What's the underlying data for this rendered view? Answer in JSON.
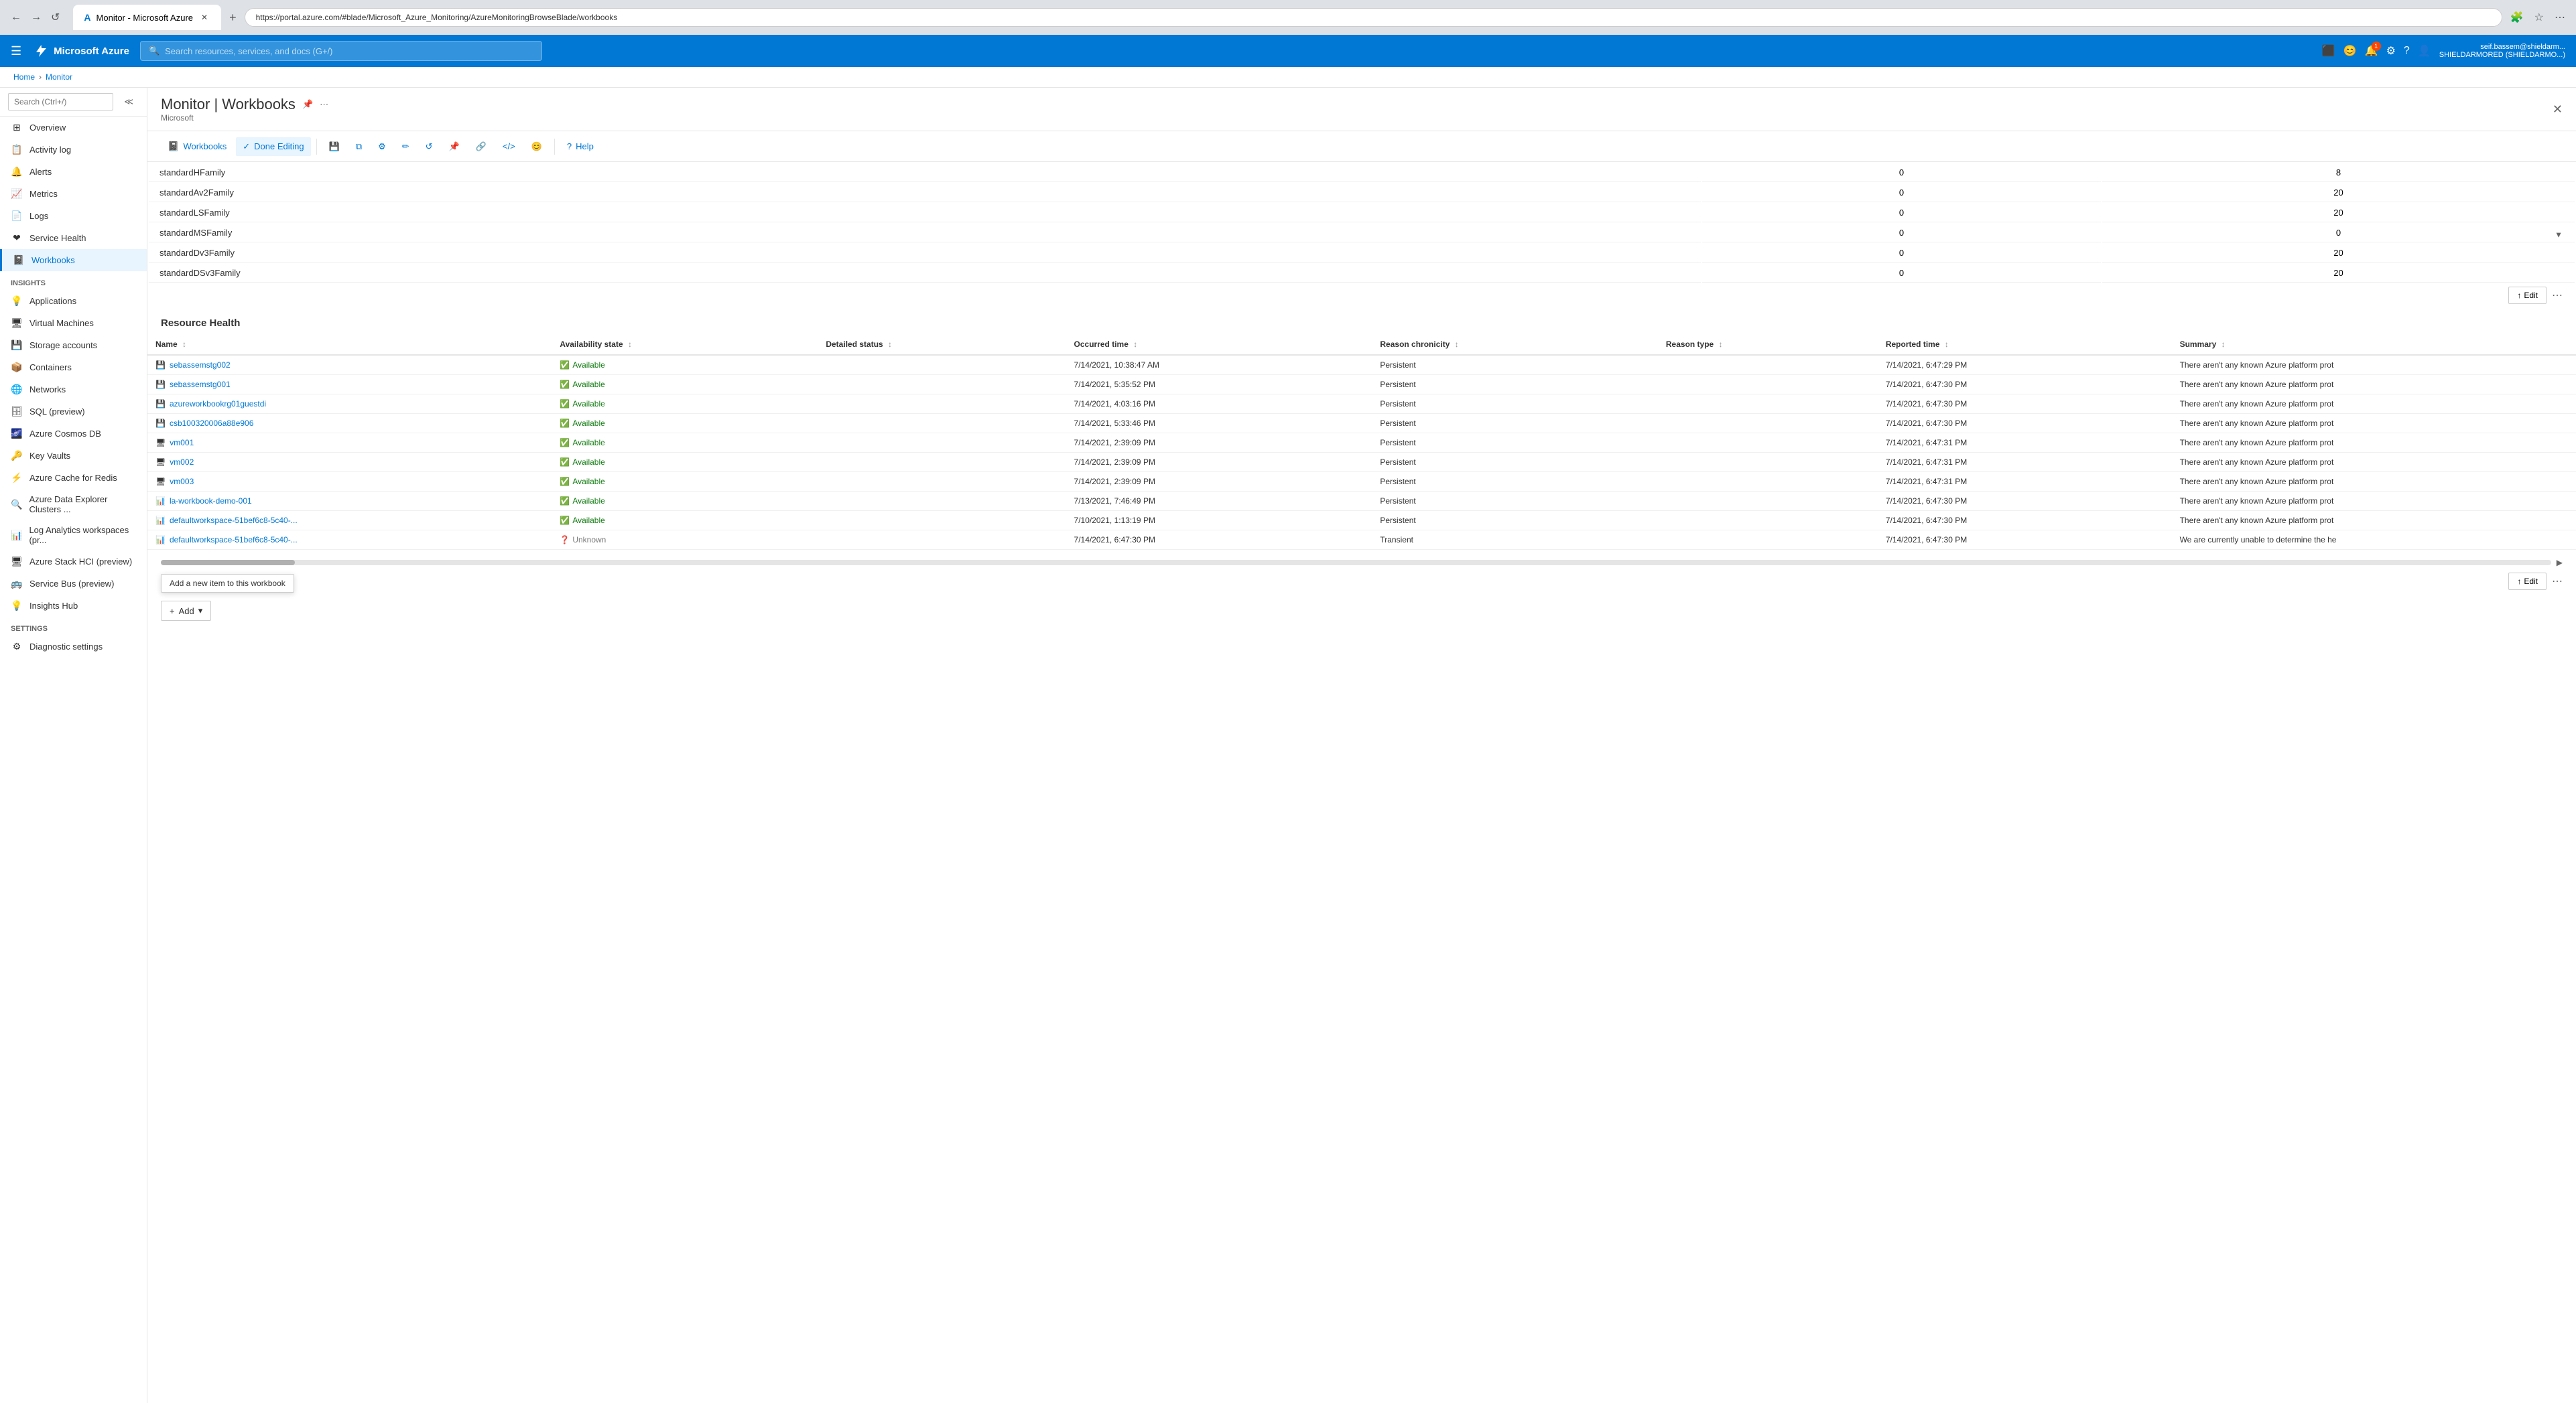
{
  "browser": {
    "tab_title": "Monitor - Microsoft Azure",
    "url": "https://portal.azure.com/#blade/Microsoft_Azure_Monitoring/AzureMonitoringBrowseBlade/workbooks",
    "favicon": "M"
  },
  "topbar": {
    "app_name": "Microsoft Azure",
    "search_placeholder": "Search resources, services, and docs (G+/)",
    "notification_count": "1",
    "user_name": "seif.bassem@shieldarm...",
    "user_org": "SHIELDARMORED (SHIELDARMO...)"
  },
  "breadcrumb": {
    "home": "Home",
    "monitor": "Monitor"
  },
  "page": {
    "title": "Monitor | Workbooks",
    "subtitle": "Microsoft"
  },
  "toolbar": {
    "workbooks_label": "Workbooks",
    "done_editing_label": "Done Editing",
    "help_label": "Help",
    "save_tooltip": "Save",
    "copy_tooltip": "Copy",
    "settings_tooltip": "Settings",
    "edit_tooltip": "Edit",
    "refresh_tooltip": "Refresh",
    "pin_tooltip": "Pin",
    "link_tooltip": "Link",
    "code_tooltip": "Code",
    "emoji_tooltip": "Emoji"
  },
  "sidebar": {
    "search_placeholder": "Search (Ctrl+/)",
    "items": [
      {
        "label": "Overview",
        "icon": "⊞",
        "active": false
      },
      {
        "label": "Activity log",
        "icon": "📋",
        "active": false
      },
      {
        "label": "Alerts",
        "icon": "🔔",
        "active": false
      },
      {
        "label": "Metrics",
        "icon": "📈",
        "active": false
      },
      {
        "label": "Logs",
        "icon": "📄",
        "active": false
      },
      {
        "label": "Service Health",
        "icon": "❤",
        "active": false
      },
      {
        "label": "Workbooks",
        "icon": "📓",
        "active": true
      }
    ],
    "insights_section": "Insights",
    "insights_items": [
      {
        "label": "Applications",
        "icon": "💡"
      },
      {
        "label": "Virtual Machines",
        "icon": "🖥"
      },
      {
        "label": "Storage accounts",
        "icon": "💾"
      },
      {
        "label": "Containers",
        "icon": "📦"
      },
      {
        "label": "Networks",
        "icon": "🌐"
      },
      {
        "label": "SQL (preview)",
        "icon": "🗄"
      },
      {
        "label": "Azure Cosmos DB",
        "icon": "🌌"
      },
      {
        "label": "Key Vaults",
        "icon": "🔑"
      },
      {
        "label": "Azure Cache for Redis",
        "icon": "⚡"
      },
      {
        "label": "Azure Data Explorer Clusters ...",
        "icon": "🔍"
      },
      {
        "label": "Log Analytics workspaces (pr...",
        "icon": "📊"
      },
      {
        "label": "Azure Stack HCI (preview)",
        "icon": "🖥"
      },
      {
        "label": "Service Bus (preview)",
        "icon": "🚌"
      },
      {
        "label": "Insights Hub",
        "icon": "💡"
      }
    ],
    "settings_section": "Settings",
    "settings_items": [
      {
        "label": "Diagnostic settings",
        "icon": "⚙"
      }
    ]
  },
  "family_table": {
    "rows": [
      {
        "name": "standardHFamily",
        "col2": "0",
        "col3": "8"
      },
      {
        "name": "standardAv2Family",
        "col2": "0",
        "col3": "20"
      },
      {
        "name": "standardLSFamily",
        "col2": "0",
        "col3": "20"
      },
      {
        "name": "standardMSFamily",
        "col2": "0",
        "col3": "0"
      },
      {
        "name": "standardDv3Family",
        "col2": "0",
        "col3": "20"
      },
      {
        "name": "standardDSv3Family",
        "col2": "0",
        "col3": "20"
      }
    ]
  },
  "resource_health": {
    "section_title": "Resource Health",
    "edit_btn_label": "↑ Edit",
    "more_btn_label": "...",
    "columns": [
      {
        "label": "Name"
      },
      {
        "label": "Availability state"
      },
      {
        "label": "Detailed status"
      },
      {
        "label": "Occurred time"
      },
      {
        "label": "Reason chronicity"
      },
      {
        "label": "Reason type"
      },
      {
        "label": "Reported time"
      },
      {
        "label": "Summary"
      }
    ],
    "rows": [
      {
        "name": "sebassemstg002",
        "type": "storage",
        "availability": "Available",
        "detailed_status": "",
        "occurred_time": "7/14/2021, 10:38:47 AM",
        "reason_chronicity": "Persistent",
        "reason_type": "",
        "reported_time": "7/14/2021, 6:47:29 PM",
        "summary": "There aren't any known Azure platform prot"
      },
      {
        "name": "sebassemstg001",
        "type": "storage",
        "availability": "Available",
        "detailed_status": "",
        "occurred_time": "7/14/2021, 5:35:52 PM",
        "reason_chronicity": "Persistent",
        "reason_type": "",
        "reported_time": "7/14/2021, 6:47:30 PM",
        "summary": "There aren't any known Azure platform prot"
      },
      {
        "name": "azureworkbookrg01guestdi",
        "type": "storage",
        "availability": "Available",
        "detailed_status": "",
        "occurred_time": "7/14/2021, 4:03:16 PM",
        "reason_chronicity": "Persistent",
        "reason_type": "",
        "reported_time": "7/14/2021, 6:47:30 PM",
        "summary": "There aren't any known Azure platform prot"
      },
      {
        "name": "csb100320006a88e906",
        "type": "storage",
        "availability": "Available",
        "detailed_status": "",
        "occurred_time": "7/14/2021, 5:33:46 PM",
        "reason_chronicity": "Persistent",
        "reason_type": "",
        "reported_time": "7/14/2021, 6:47:30 PM",
        "summary": "There aren't any known Azure platform prot"
      },
      {
        "name": "vm001",
        "type": "vm",
        "availability": "Available",
        "detailed_status": "",
        "occurred_time": "7/14/2021, 2:39:09 PM",
        "reason_chronicity": "Persistent",
        "reason_type": "",
        "reported_time": "7/14/2021, 6:47:31 PM",
        "summary": "There aren't any known Azure platform prot"
      },
      {
        "name": "vm002",
        "type": "vm",
        "availability": "Available",
        "detailed_status": "",
        "occurred_time": "7/14/2021, 2:39:09 PM",
        "reason_chronicity": "Persistent",
        "reason_type": "",
        "reported_time": "7/14/2021, 6:47:31 PM",
        "summary": "There aren't any known Azure platform prot"
      },
      {
        "name": "vm003",
        "type": "vm",
        "availability": "Available",
        "detailed_status": "",
        "occurred_time": "7/14/2021, 2:39:09 PM",
        "reason_chronicity": "Persistent",
        "reason_type": "",
        "reported_time": "7/14/2021, 6:47:31 PM",
        "summary": "There aren't any known Azure platform prot"
      },
      {
        "name": "la-workbook-demo-001",
        "type": "loganalytics",
        "availability": "Available",
        "detailed_status": "",
        "occurred_time": "7/13/2021, 7:46:49 PM",
        "reason_chronicity": "Persistent",
        "reason_type": "",
        "reported_time": "7/14/2021, 6:47:30 PM",
        "summary": "There aren't any known Azure platform prot"
      },
      {
        "name": "defaultworkspace-51bef6c8-5c40-...",
        "type": "loganalytics",
        "availability": "Available",
        "detailed_status": "",
        "occurred_time": "7/10/2021, 1:13:19 PM",
        "reason_chronicity": "Persistent",
        "reason_type": "",
        "reported_time": "7/14/2021, 6:47:30 PM",
        "summary": "There aren't any known Azure platform prot"
      },
      {
        "name": "defaultworkspace-51bef6c8-5c40-...",
        "type": "loganalytics",
        "availability": "Unknown",
        "detailed_status": "",
        "occurred_time": "7/14/2021, 6:47:30 PM",
        "reason_chronicity": "Transient",
        "reason_type": "",
        "reported_time": "7/14/2021, 6:47:30 PM",
        "summary": "We are currently unable to determine the he"
      }
    ]
  },
  "bottom_actions": {
    "add_label": "Add",
    "tooltip": "Add a new item to this workbook"
  },
  "section_edit_buttons": [
    {
      "label": "↑ Edit"
    },
    {
      "label": "↑ Edit"
    }
  ]
}
